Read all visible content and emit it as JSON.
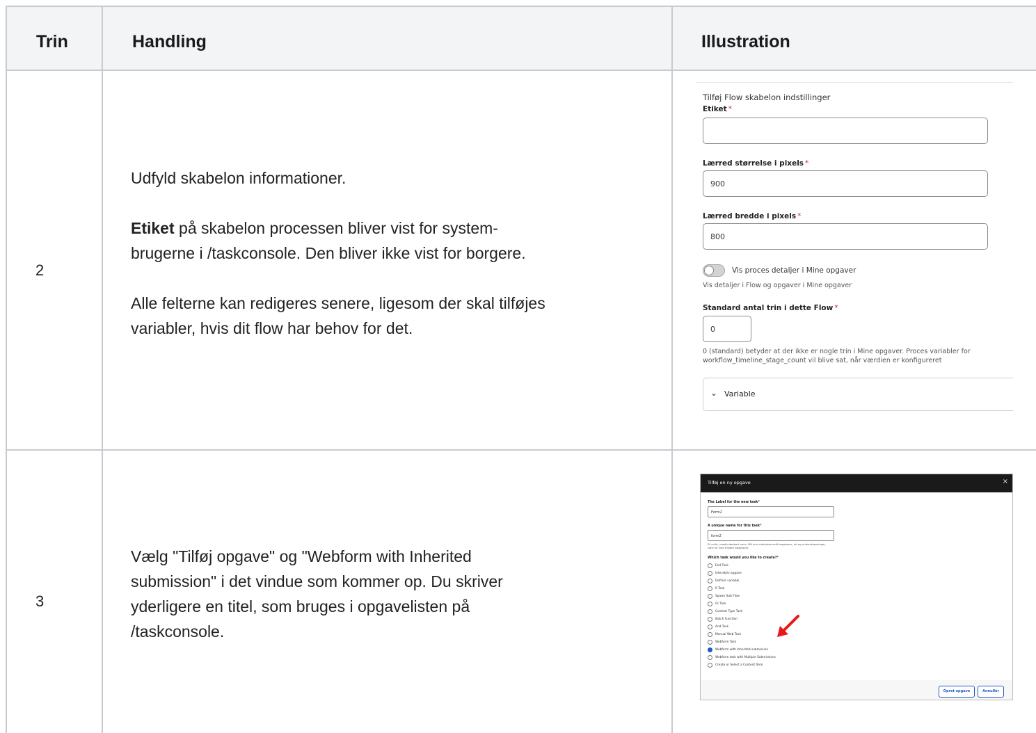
{
  "table": {
    "headers": {
      "step": "Trin",
      "action": "Handling",
      "illustration": "Illustration"
    },
    "rows": [
      {
        "step": "2",
        "lead_bold": "Etiket",
        "p1": "Udfyld skabelon informationer.",
        "p2_line1_rest": " på skabelon processen bliver vist for system-",
        "p2_line2": "brugerne i /taskconsole. Den bliver ikke vist for borgere.",
        "p3_line1": "Alle felterne kan redigeres senere, ligesom der skal tilføjes",
        "p3_line2": "variabler, hvis dit flow har behov for det."
      },
      {
        "step": "3",
        "line1": "Vælg \"Tilføj opgave\" og \"Webform with Inherited",
        "line2": "submission\" i det vindue som kommer op. Du skriver",
        "line3": "yderligere en titel, som bruges i opgavelisten på",
        "line4": "/taskconsole."
      }
    ]
  },
  "form_illustration": {
    "title": "Tilføj Flow skabelon indstillinger",
    "label_field": "Etiket",
    "label_value": "",
    "canvas_size_label": "Lærred størrelse i pixels",
    "canvas_size_value": "900",
    "canvas_width_label": "Lærred bredde i pixels",
    "canvas_width_value": "800",
    "toggle_label": "Vis proces detaljer i Mine opgaver",
    "toggle_desc": "Vis detaljer i Flow og opgaver i Mine opgaver",
    "steps_label": "Standard antal trin i dette Flow",
    "steps_value": "0",
    "steps_help_1": "0 (standard) betyder at der ikke er nogle trin i Mine opgaver. Proces variabler for",
    "steps_help_2": "workflow_timeline_stage_count vil blive sat, når værdien er konfigureret",
    "variable_section": "Variable",
    "required_mark": "*"
  },
  "dialog_illustration": {
    "title": "Tilføj en ny opgave",
    "close": "×",
    "label_new_task": "The Label for the new task",
    "label_new_task_value": "Form2",
    "unique_name": "A unique name for this task",
    "unique_name_value": "form2",
    "unique_hint_1": "Et unikt, maskinlæsbart navn. Må kun indeholde små bogstaver, tal og understregninger,",
    "unique_hint_2": "slash er ikke tilladte bogstaver.",
    "which_task": "Which task would you like to create?",
    "options": [
      "End Task",
      "Interaktiv opgave",
      "Definér variabel",
      "If Task",
      "Spawn Sub Flow",
      "Or Task",
      "Content Type Task",
      "Batch Function",
      "And Task",
      "Manual Web Task",
      "Webform Task",
      "Webform with Inherited submission",
      "Webform task with Multiple Submissions",
      "Create or Select a Content Item"
    ],
    "selected_option": "Webform with Inherited submission",
    "create_button": "Opret opgave",
    "cancel_button": "Annullér",
    "required_mark": "*"
  }
}
